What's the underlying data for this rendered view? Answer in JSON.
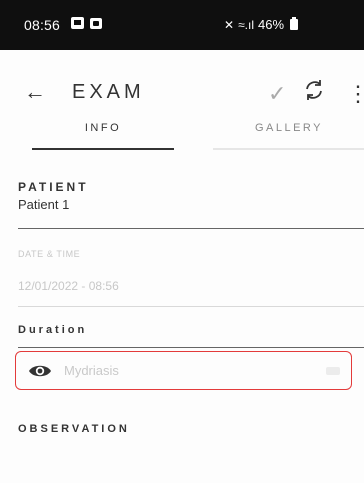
{
  "status_bar": {
    "time": "08:56",
    "battery": "46%"
  },
  "app_bar": {
    "back_icon": "arrow-left-icon",
    "title": "EXAM",
    "check_icon": "check-icon",
    "sync_icon": "sync-icon",
    "more_icon": "more-vertical-icon"
  },
  "tabs": [
    {
      "label": "INFO",
      "active": true
    },
    {
      "label": "GALLERY",
      "active": false
    }
  ],
  "patient": {
    "label": "PATIENT",
    "value": "Patient 1"
  },
  "date_time": {
    "label": "DATE & TIME",
    "value": "12/01/2022 - 08:56"
  },
  "duration": {
    "label": "Duration"
  },
  "mydriasis": {
    "label": "Mydriasis",
    "icon": "eye-icon",
    "highlight_color": "#e33b3b"
  },
  "observation": {
    "label": "OBSERVATION"
  }
}
